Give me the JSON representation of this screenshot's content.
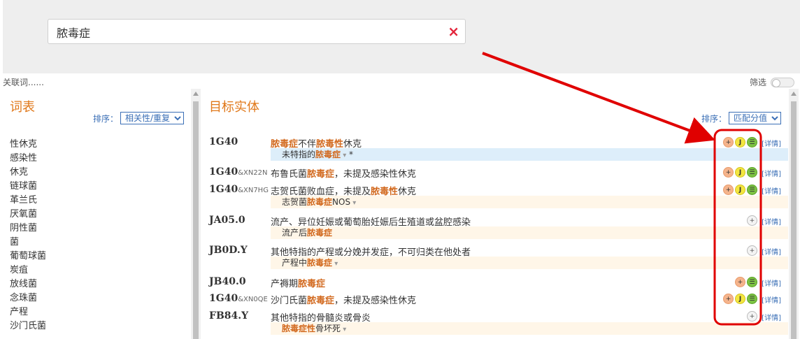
{
  "search": {
    "value": "脓毒症",
    "clear_icon": "×"
  },
  "related_label": "关联词......",
  "filter_label": "筛选",
  "left": {
    "title": "词表",
    "sort_label": "排序：",
    "sort_value": "相关性/重复",
    "words": [
      "性休克",
      "感染性",
      "休克",
      "链球菌",
      "革兰氏",
      "厌氧菌",
      "阴性菌",
      "菌",
      "葡萄球菌",
      "炭疽",
      "放线菌",
      "念珠菌",
      "产程",
      "沙门氏菌"
    ]
  },
  "right": {
    "title": "目标实体",
    "sort_label": "排序：",
    "sort_value": "匹配分值",
    "detail_label": "[详情]",
    "entities": [
      {
        "code": "1G40",
        "suffix": "",
        "title_parts": [
          [
            "脓毒症",
            true
          ],
          [
            "不伴",
            false
          ],
          [
            "脓毒性",
            true
          ],
          [
            "休克",
            false
          ]
        ],
        "sub": [
          [
            "未特指的",
            false
          ],
          [
            "脓毒症",
            true
          ]
        ],
        "sub_extra": " *",
        "sub_blue": true,
        "icons": [
          "plus",
          "j",
          "eq"
        ]
      },
      {
        "code": "1G40",
        "suffix": "&XN22N",
        "title_parts": [
          [
            "布鲁氏菌",
            false
          ],
          [
            "脓毒症",
            true
          ],
          [
            "，未提及感染性休克",
            false
          ]
        ],
        "sub": null,
        "icons": [
          "plus",
          "j",
          "eq"
        ]
      },
      {
        "code": "1G40",
        "suffix": "&XN7HG",
        "title_parts": [
          [
            "志贺氏菌败血症，未提及",
            false
          ],
          [
            "脓毒性",
            true
          ],
          [
            "休克",
            false
          ]
        ],
        "sub": [
          [
            "志贺菌",
            false
          ],
          [
            "脓毒症",
            true
          ],
          [
            "NOS",
            false
          ]
        ],
        "sub_extra": "",
        "sub_blue": false,
        "icons": [
          "plus",
          "j",
          "eq"
        ]
      },
      {
        "code": "JA05.0",
        "suffix": "",
        "title_parts": [
          [
            "流产、异位妊娠或葡萄胎妊娠后生殖道或盆腔感染",
            false
          ]
        ],
        "sub": [
          [
            "流产后",
            false
          ],
          [
            "脓毒症",
            true
          ]
        ],
        "sub_extra": "",
        "sub_blue": false,
        "icons": [
          "plusg"
        ],
        "no_caret": true
      },
      {
        "code": "JB0D.Y",
        "suffix": "",
        "title_parts": [
          [
            "其他特指的产程或分娩并发症，不可归类在他处者",
            false
          ]
        ],
        "sub": [
          [
            "产程中",
            false
          ],
          [
            "脓毒症",
            true
          ]
        ],
        "sub_extra": "",
        "sub_blue": false,
        "icons": [
          "plusg"
        ]
      },
      {
        "code": "JB40.0",
        "suffix": "",
        "title_parts": [
          [
            "产褥期",
            false
          ],
          [
            "脓毒症",
            true
          ]
        ],
        "sub": null,
        "icons": [
          "plus",
          "eq"
        ]
      },
      {
        "code": "1G40",
        "suffix": "&XN0QE",
        "title_parts": [
          [
            "沙门氏菌",
            false
          ],
          [
            "脓毒症",
            true
          ],
          [
            "，未提及感染性休克",
            false
          ]
        ],
        "sub": null,
        "icons": [
          "plus",
          "j",
          "eq"
        ]
      },
      {
        "code": "FB84.Y",
        "suffix": "",
        "title_parts": [
          [
            "其他特指的骨髓炎或骨炎",
            false
          ]
        ],
        "sub": [
          [
            "脓毒症性",
            true
          ],
          [
            "骨坏死",
            false
          ]
        ],
        "sub_extra": "",
        "sub_blue": false,
        "icons": [
          "plusg"
        ]
      }
    ]
  },
  "colors": {
    "highlight": "#d2691e",
    "annotation": "#e00000",
    "accent": "#3b6fb6"
  }
}
